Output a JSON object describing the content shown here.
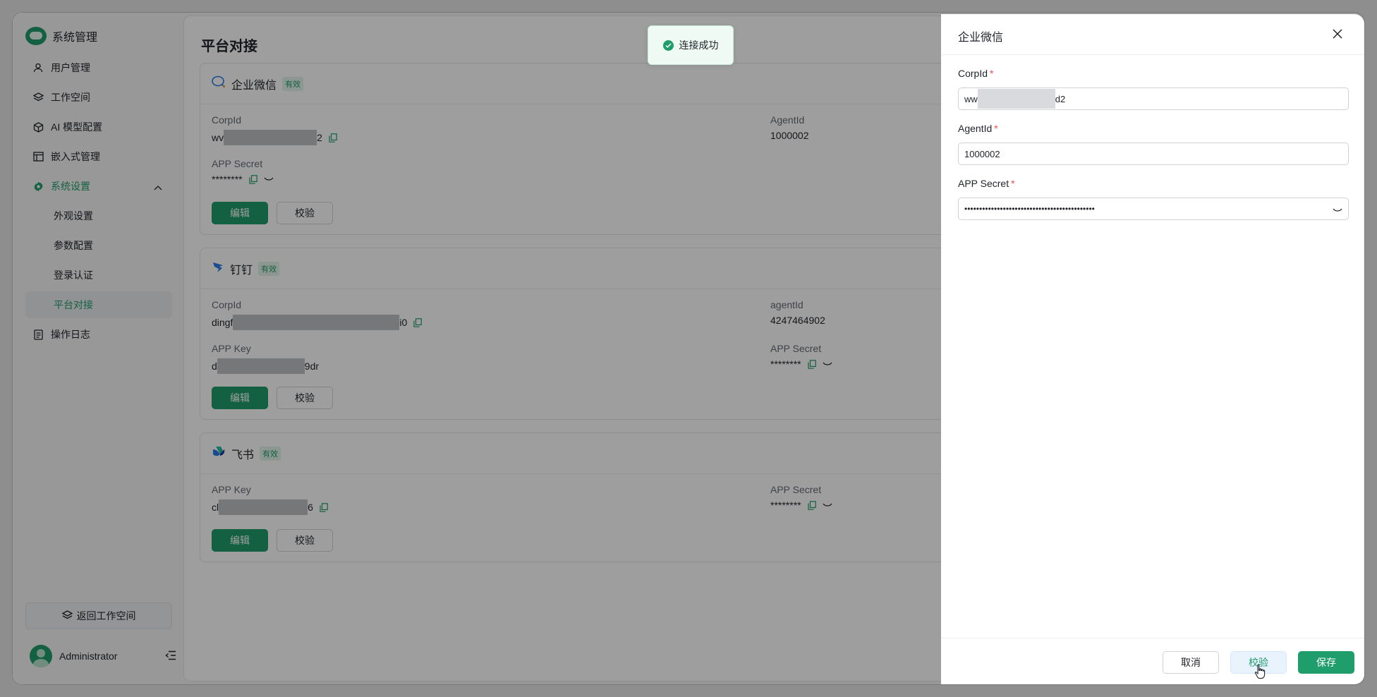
{
  "app": {
    "title": "系统管理"
  },
  "sidebar": {
    "items": [
      {
        "label": "用户管理",
        "icon": "user-icon"
      },
      {
        "label": "工作空间",
        "icon": "layers-icon"
      },
      {
        "label": "AI 模型配置",
        "icon": "cube-icon"
      },
      {
        "label": "嵌入式管理",
        "icon": "window-icon"
      },
      {
        "label": "系统设置",
        "icon": "gear-icon"
      },
      {
        "label": "操作日志",
        "icon": "document-icon"
      }
    ],
    "sub_items": [
      "外观设置",
      "参数配置",
      "登录认证",
      "平台对接"
    ],
    "active_sub": "平台对接",
    "return_label": "返回工作空间",
    "user_name": "Administrator"
  },
  "main": {
    "page_title": "平台对接",
    "cards": [
      {
        "name": "企业微信",
        "badge": "有效",
        "fields": [
          {
            "label": "CorpId",
            "prefix": "wv",
            "suffix": "2"
          },
          {
            "label": "AgentId",
            "value": "1000002"
          },
          {
            "label": "APP Secret",
            "value": "********"
          }
        ],
        "edit_label": "编辑",
        "verify_label": "校验"
      },
      {
        "name": "钉钉",
        "badge": "有效",
        "fields": [
          {
            "label": "CorpId",
            "prefix": "dingf",
            "suffix": "i0"
          },
          {
            "label": "agentId",
            "value": "4247464902"
          },
          {
            "label": "APP Key",
            "prefix": "d",
            "suffix": "9dr"
          },
          {
            "label": "APP Secret",
            "value": "********"
          }
        ],
        "edit_label": "编辑",
        "verify_label": "校验"
      },
      {
        "name": "飞书",
        "badge": "有效",
        "fields": [
          {
            "label": "APP Key",
            "prefix": "cl",
            "suffix": "6"
          },
          {
            "label": "APP Secret",
            "value": "********"
          }
        ],
        "edit_label": "编辑",
        "verify_label": "校验"
      }
    ]
  },
  "toast": {
    "message": "连接成功"
  },
  "drawer": {
    "title": "企业微信",
    "fields": [
      {
        "label": "CorpId",
        "prefix": "ww",
        "suffix": "d2"
      },
      {
        "label": "AgentId",
        "value": "1000002"
      },
      {
        "label": "APP Secret",
        "value": "••••••••••••••••••••••••••••••••••••••••••••"
      }
    ],
    "required_mark": "*",
    "cancel_label": "取消",
    "verify_label": "校验",
    "save_label": "保存"
  },
  "colors": {
    "brand": "#1f9d6b",
    "required": "#f54a45",
    "overlay": "rgba(0,0,0,0.38)"
  }
}
